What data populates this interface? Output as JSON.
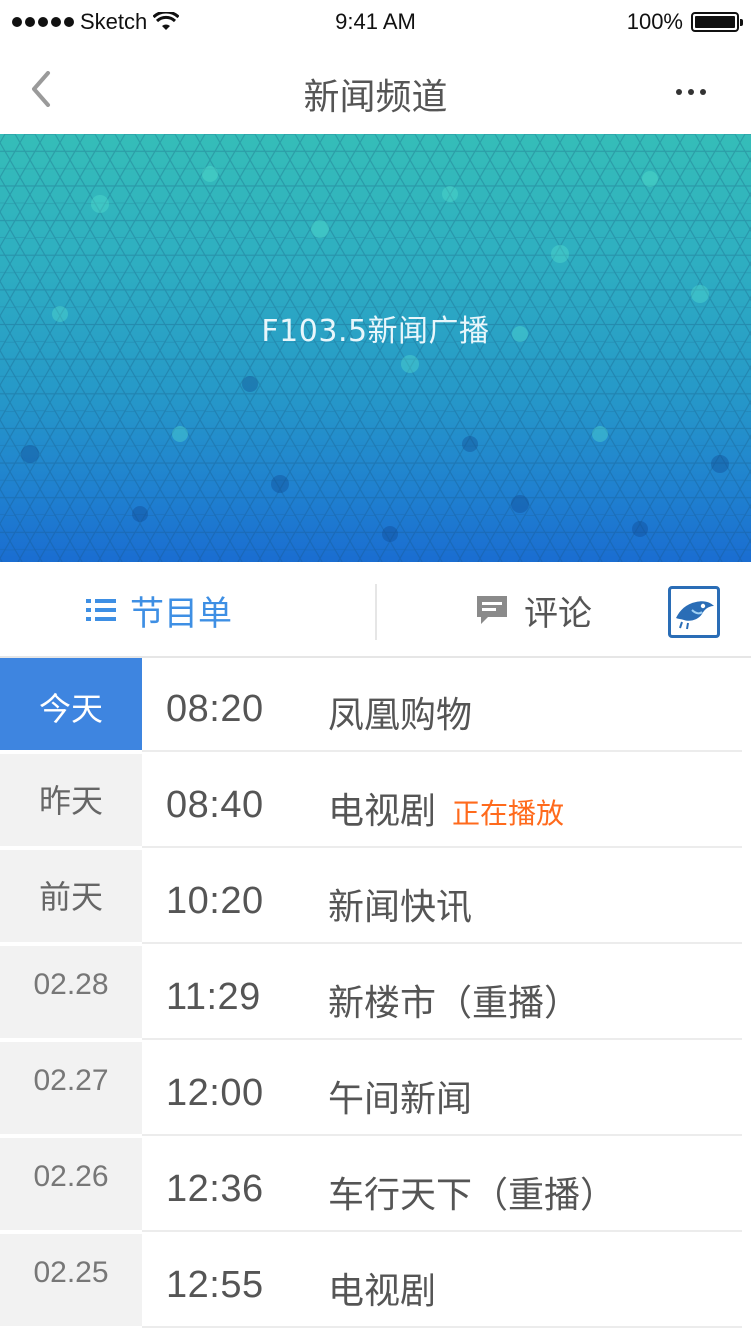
{
  "status_bar": {
    "carrier": "Sketch",
    "time": "9:41 AM",
    "battery": "100%"
  },
  "nav": {
    "title": "新闻频道"
  },
  "banner": {
    "title": "F103.5新闻广播"
  },
  "tabs": {
    "schedule_label": "节目单",
    "comments_label": "评论"
  },
  "days": [
    "今天",
    "昨天",
    "前天",
    "02.28",
    "02.27",
    "02.26",
    "02.25"
  ],
  "programs": [
    {
      "time": "08:20",
      "name": "凤凰购物",
      "badge": ""
    },
    {
      "time": "08:40",
      "name": "电视剧",
      "badge": "正在播放"
    },
    {
      "time": "10:20",
      "name": "新闻快讯",
      "badge": ""
    },
    {
      "time": "11:29",
      "name": "新楼市（重播）",
      "badge": ""
    },
    {
      "time": "12:00",
      "name": "午间新闻",
      "badge": ""
    },
    {
      "time": "12:36",
      "name": "车行天下（重播）",
      "badge": ""
    },
    {
      "time": "12:55",
      "name": "电视剧",
      "badge": ""
    }
  ],
  "colors": {
    "accent": "#3e85e0",
    "live": "#ff6a1c",
    "banner_top": "#35bdb8",
    "banner_bottom": "#1a6dd1"
  }
}
